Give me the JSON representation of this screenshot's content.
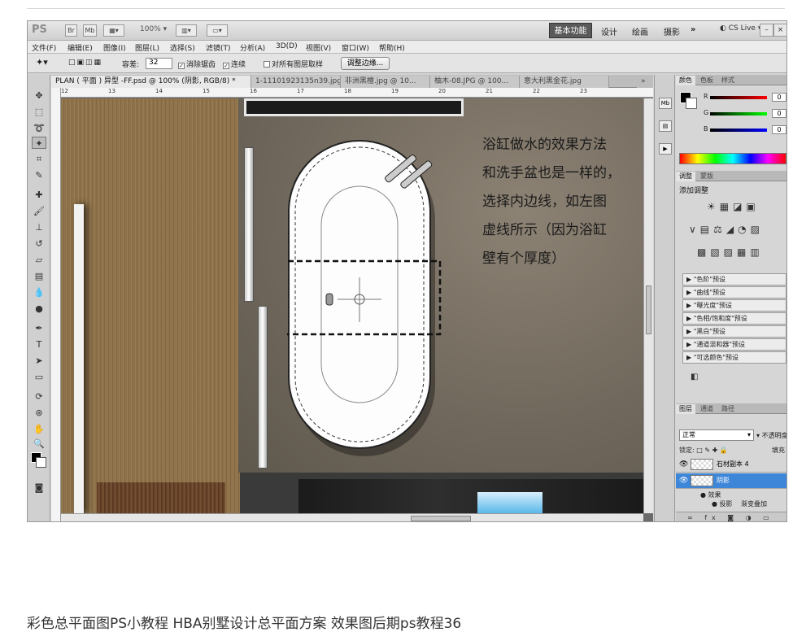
{
  "app": {
    "logo": "PS",
    "mini_buttons": [
      "Br",
      "Mb"
    ],
    "zoom": "100%",
    "workspaces": {
      "basic": "基本功能",
      "design": "设计",
      "paint": "绘画",
      "photo": "摄影",
      "more": "»"
    },
    "cslive": "CS Live",
    "window_buttons": [
      "–",
      "□",
      "×"
    ]
  },
  "menu": [
    "文件(F)",
    "编辑(E)",
    "图像(I)",
    "图层(L)",
    "选择(S)",
    "滤镜(T)",
    "分析(A)",
    "3D(D)",
    "视图(V)",
    "窗口(W)",
    "帮助(H)"
  ],
  "options": {
    "tolerance_label": "容差:",
    "tolerance_value": "32",
    "anti_alias": "消除锯齿",
    "contiguous": "连续",
    "sample_all": "对所有图层取样",
    "refine_edge": "调整边缘..."
  },
  "tabs": [
    "PLAN ( 平面 ) 异型 -FF.psd @ 100% (阴影, RGB/8) *",
    "1-11101923135n39.jpg",
    "非洲黑檀.jpg @ 10...",
    "柚木-08.JPG @ 100...",
    "意大利黑金花.jpg"
  ],
  "ruler": [
    "12",
    "13",
    "14",
    "15",
    "16",
    "17",
    "18",
    "19",
    "20",
    "21",
    "22",
    "23"
  ],
  "annotation": [
    "浴缸做水的效果方法",
    "和洗手盆也是一样的，",
    "选择内边线，如左图",
    "虚线所示（因为浴缸",
    "壁有个厚度）"
  ],
  "color_panel": {
    "tabs": [
      "颜色",
      "色板",
      "样式"
    ],
    "r_label": "R",
    "g_label": "G",
    "b_label": "B",
    "r_value": "0",
    "g_value": "0",
    "b_value": "0"
  },
  "adjust_panel": {
    "tabs": [
      "调整",
      "蒙版"
    ],
    "title": "添加调整",
    "presets": [
      "\"色阶\"预设",
      "\"曲线\"预设",
      "\"曝光度\"预设",
      "\"色相/饱和度\"预设",
      "\"黑白\"预设",
      "\"通道混和器\"预设",
      "\"可选颜色\"预设"
    ]
  },
  "layers_panel": {
    "tabs": [
      "图层",
      "通道",
      "路径"
    ],
    "blend_mode": "正常",
    "opacity_label": "不透明度",
    "lock_label": "锁定:",
    "fill_label": "填充",
    "layers": [
      "石材副本 4",
      "阴影"
    ],
    "effects_label": "效果",
    "drop_shadow": "投影",
    "gradient_overlay": "渐变叠加"
  },
  "caption": "彩色总平面图PS小教程 HBA别墅设计总平面方案 效果图后期ps教程36"
}
